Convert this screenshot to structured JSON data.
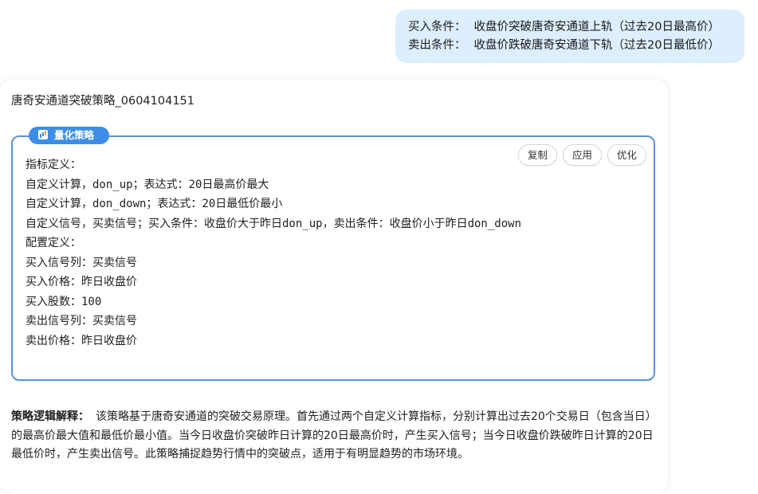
{
  "user_message": {
    "buy": {
      "label": "买入条件：",
      "text": "收盘价突破唐奇安通道上轨（过去20日最高价）"
    },
    "sell": {
      "label": "卖出条件：",
      "text": "收盘价跌破唐奇安通道下轨（过去20日最低价）"
    }
  },
  "reply": {
    "strategy_name": "唐奇安通道突破策略_0604104151",
    "badge": {
      "icon": "chart-icon",
      "label": "量化策略"
    },
    "actions": {
      "copy": "复制",
      "apply": "应用",
      "optimize": "优化"
    },
    "definition_lines": [
      "指标定义：",
      "自定义计算，don_up；表达式：20日最高价最大",
      "自定义计算，don_down；表达式：20日最低价最小",
      "自定义信号，买卖信号；买入条件：收盘价大于昨日don_up，卖出条件：收盘价小于昨日don_down",
      "配置定义：",
      "买入信号列：买卖信号",
      "买入价格：昨日收盘价",
      "买入股数：100",
      "卖出信号列：买卖信号",
      "卖出价格：昨日收盘价"
    ],
    "explanation": {
      "label": "策略逻辑解释：",
      "text": "该策略基于唐奇安通道的突破交易原理。首先通过两个自定义计算指标，分别计算出过去20个交易日（包含当日）的最高价最大值和最低价最小值。当今日收盘价突破昨日计算的20日最高价时，产生买入信号；当今日收盘价跌破昨日计算的20日最低价时，产生卖出信号。此策略捕捉趋势行情中的突破点，适用于有明显趋势的市场环境。"
    }
  },
  "colors": {
    "user_bubble": "#ddeeff",
    "accent": "#3c8ee6",
    "box_border": "#5b93d6"
  }
}
